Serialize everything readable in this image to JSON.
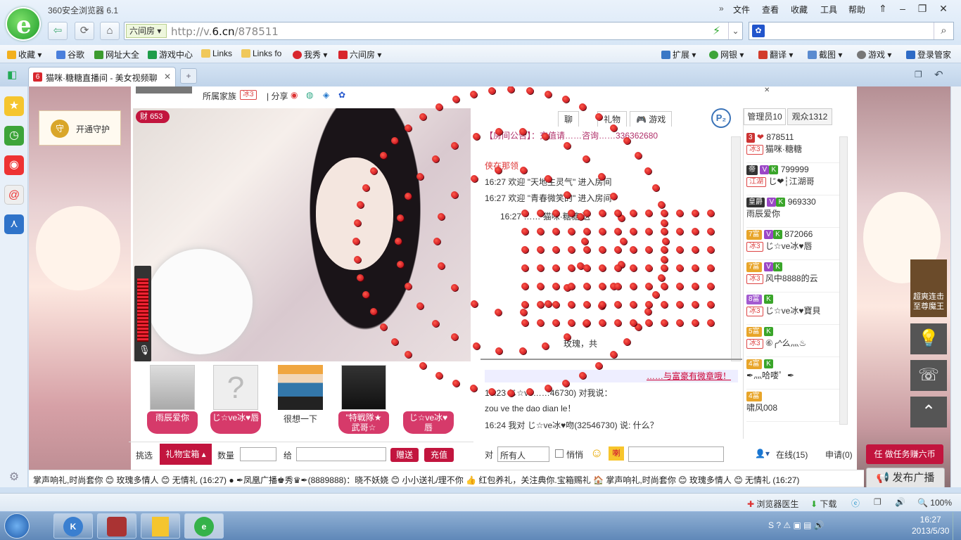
{
  "browser": {
    "app_title": "360安全浏览器 6.1",
    "menu": [
      "文件",
      "查看",
      "收藏",
      "工具",
      "帮助"
    ],
    "url_tag": "六间房",
    "url_prefix": "http://v.",
    "url_domain": "6.cn",
    "url_path": "/878511",
    "search_placeholder": ""
  },
  "bookmarks": {
    "left": [
      "收藏",
      "谷歌",
      "网址大全",
      "游戏中心",
      "Links",
      "Links fo",
      "我秀",
      "六间房"
    ],
    "right": [
      "扩展",
      "网银",
      "翻译",
      "截图",
      "游戏",
      "登录管家"
    ]
  },
  "tab": {
    "title": "猫咪·糖糖直播间 - 美女视频聊"
  },
  "page": {
    "family_label": "所属家族",
    "family_badge": "冰3",
    "share_label": "| 分享",
    "guard_label": "开通守护",
    "wealth_badge": "财",
    "wealth_count": "653",
    "fans": [
      {
        "name": "雨辰爱你"
      },
      {
        "name": "じ☆ve冰♥唇"
      },
      {
        "name": "很想一下"
      },
      {
        "name": "\"特戦隊★\n武哥☆"
      },
      {
        "name": "じ☆ve冰♥\n唇"
      }
    ],
    "gift_bar": {
      "pick": "挑选",
      "gift_tab": "礼物宝箱",
      "qty": "数量",
      "give": "给",
      "send": "赠送",
      "recharge": "充值"
    },
    "chat": {
      "tabs": [
        "聊",
        "礼物",
        "游戏"
      ],
      "announcement": "【房间公告】：充值请……咨询……336362680",
      "lines": [
        {
          "text": "侠在那领",
          "color": "#d33"
        },
        {
          "text": "16:27 欢迎 \"天地生灵气\" 进入房间",
          "color": "#333"
        },
        {
          "text": "16:27 欢迎 \"青春微笑的\" 进入房间",
          "color": "#333"
        },
        {
          "text": "16:27 …… 猫咪·糖糖 送",
          "color": "#333"
        },
        {
          "text": "玫瑰，共",
          "color": "#333"
        }
      ],
      "private_header": "……与富豪有微章哦！",
      "private_lines": [
        "16:23 じ☆ve……46730) 对我说：",
        "zou ve   the   dao   dian le！",
        "16:24 我对 じ☆ve冰♥吻(32546730) 说: 什么？"
      ],
      "to_label": "对",
      "to_value": "所有人",
      "whisper": "悄悄",
      "online_label": "在线(15)",
      "apply_label": "申请(0)"
    },
    "userlist": {
      "tabs": [
        "管理员10",
        "观众1312"
      ],
      "users": [
        {
          "level": "3",
          "id": "878511",
          "badge": "冰3",
          "name": "猫咪·糖糖"
        },
        {
          "level": "帝",
          "id": "799999",
          "badge": "江湖",
          "name": "じ❤┆江湖哥"
        },
        {
          "level": "皇爵",
          "id": "969330",
          "badge": "",
          "name": "雨辰爱你"
        },
        {
          "level": "7富",
          "id": "872066",
          "badge": "冰3",
          "name": "じ☆ve冰♥唇"
        },
        {
          "level": "7富",
          "id": "",
          "badge": "冰3",
          "name": "风中8888的云"
        },
        {
          "level": "8富",
          "id": "",
          "badge": "冰3",
          "name": "じ☆ve冰♥寶貝"
        },
        {
          "level": "5富",
          "id": "",
          "badge": "冰3",
          "name": "⑥╭^么灬♨"
        },
        {
          "level": "4富",
          "id": "",
          "badge": "",
          "name": "✒灬哈喽゜✒"
        },
        {
          "level": "4富",
          "id": "",
          "badge": "",
          "name": "啸风008"
        }
      ]
    },
    "task_button": "做任务赚六币",
    "broadcast_button": "发布广播",
    "marquee": "掌声响礼,时尚套你 😊 玫瑰多情人 😊 无情礼 (16:27)  ● ✒凤凰广播♚秀♛✒(8889888)：晓不妖娆 😊 小小送礼/理不你 👍 红包养礼，关注典你.宝箱赐礼 🏠 掌声响礼,时尚套你 😊 玫瑰多情人 😊 无情礼 (16:27)",
    "promo_right": [
      "超爽连击",
      "至尊魔王"
    ]
  },
  "statusbar": {
    "items": [
      "浏览器医生",
      "下载"
    ],
    "zoom": "100%"
  },
  "taskbar": {
    "time": "16:27",
    "date": "2013/5/30"
  },
  "colors": {
    "accent": "#c2153e",
    "browser_chrome": "#d7e6f6",
    "taskbar": "#5f88b8"
  }
}
